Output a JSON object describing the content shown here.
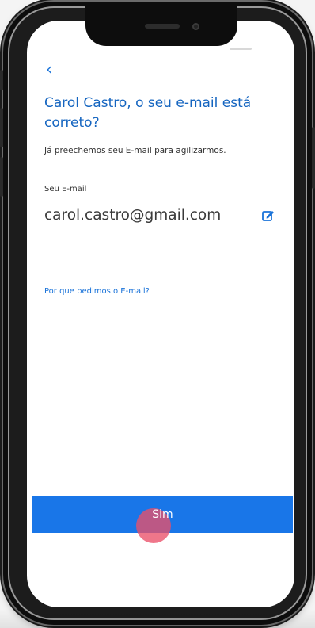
{
  "screen": {
    "back_symbol": "‹",
    "title": "Carol Castro, o seu e-mail está correto?",
    "subtitle": "Já preechemos seu E-mail para agilizarmos.",
    "email_label": "Seu E-mail",
    "email_value": "carol.castro@gmail.com",
    "edit_icon": "edit-icon",
    "why_link": "Por que pedimos o E-mail?",
    "primary_button": "Sim"
  },
  "colors": {
    "accent": "#1976e8",
    "title": "#1565c0",
    "touch_indicator": "#eb5069"
  }
}
